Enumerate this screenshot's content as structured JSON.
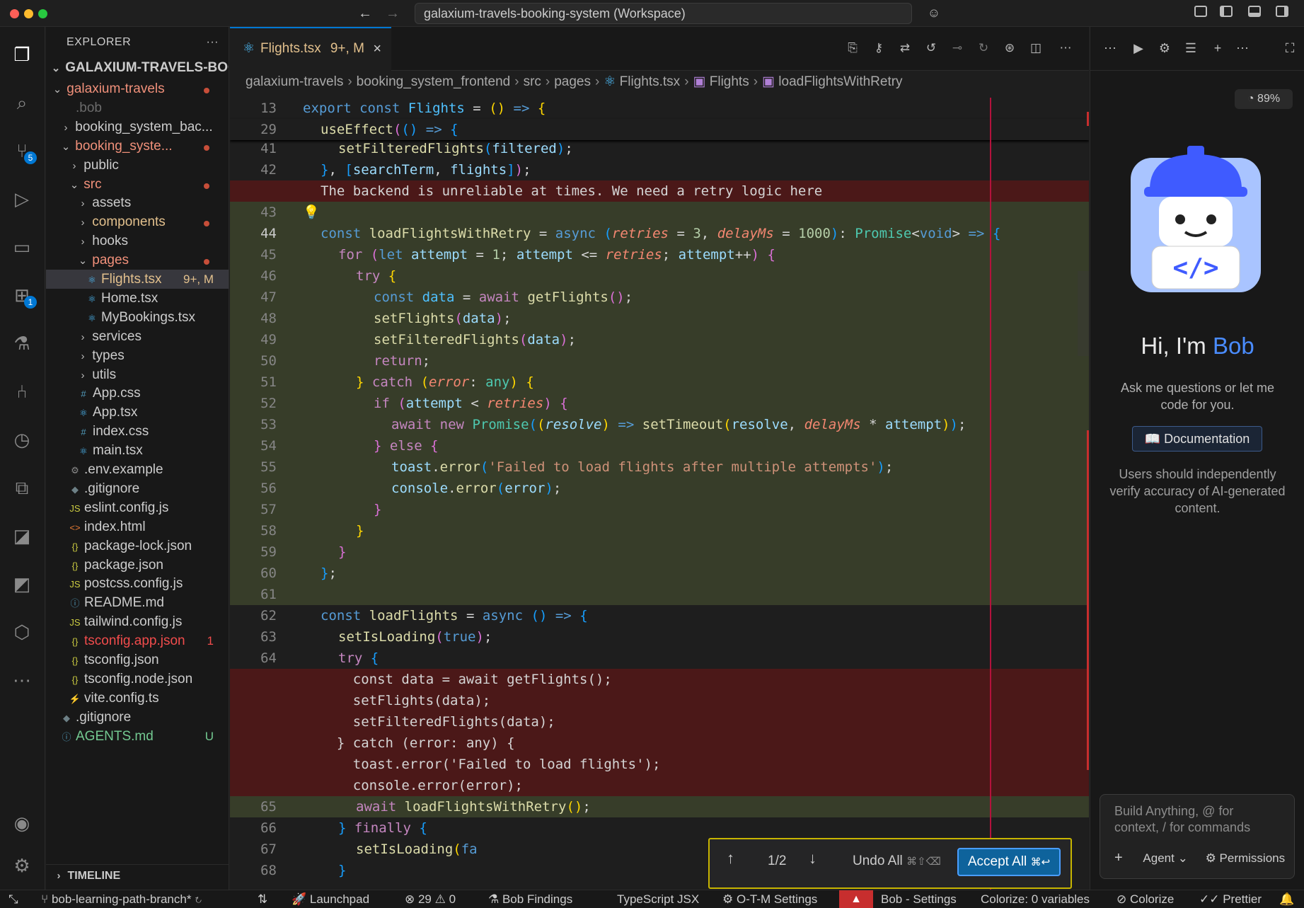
{
  "titlebar": {
    "command_center": "galaxium-travels-booking-system (Workspace)"
  },
  "activity": {
    "source_control_badge": "5",
    "extensions_badge": "1"
  },
  "explorer": {
    "title": "EXPLORER",
    "more": "···",
    "workspace_root": "GALAXIUM-TRAVELS-BOO...",
    "items": [
      {
        "label": "galaxium-travels",
        "depth": 0,
        "chev": "⌄",
        "color": "#f0907a"
      },
      {
        "label": ".bob",
        "depth": 1,
        "chev": "",
        "color": "#6b6b6b"
      },
      {
        "label": "booking_system_bac...",
        "depth": 1,
        "chev": "›",
        "color": "#cccccc"
      },
      {
        "label": "booking_syste...",
        "depth": 1,
        "chev": "⌄",
        "color": "#f0907a"
      },
      {
        "label": "public",
        "depth": 2,
        "chev": "›",
        "color": "#cccccc"
      },
      {
        "label": "src",
        "depth": 2,
        "chev": "⌄",
        "color": "#f0907a"
      },
      {
        "label": "assets",
        "depth": 3,
        "chev": "›",
        "color": "#cccccc"
      },
      {
        "label": "components",
        "depth": 3,
        "chev": "›",
        "color": "#e2c08d"
      },
      {
        "label": "hooks",
        "depth": 3,
        "chev": "›",
        "color": "#cccccc"
      },
      {
        "label": "pages",
        "depth": 3,
        "chev": "⌄",
        "color": "#f0907a"
      },
      {
        "label": "Flights.tsx",
        "depth": 4,
        "chev": "",
        "color": "#e2c08d",
        "trail": "9+, M"
      },
      {
        "label": "Home.tsx",
        "depth": 4,
        "chev": "",
        "color": "#cccccc"
      },
      {
        "label": "MyBookings.tsx",
        "depth": 4,
        "chev": "",
        "color": "#cccccc"
      },
      {
        "label": "services",
        "depth": 3,
        "chev": "›",
        "color": "#cccccc"
      },
      {
        "label": "types",
        "depth": 3,
        "chev": "›",
        "color": "#cccccc"
      },
      {
        "label": "utils",
        "depth": 3,
        "chev": "›",
        "color": "#cccccc"
      },
      {
        "label": "App.css",
        "depth": 3,
        "chev": "",
        "color": "#cccccc"
      },
      {
        "label": "App.tsx",
        "depth": 3,
        "chev": "",
        "color": "#cccccc"
      },
      {
        "label": "index.css",
        "depth": 3,
        "chev": "",
        "color": "#cccccc"
      },
      {
        "label": "main.tsx",
        "depth": 3,
        "chev": "",
        "color": "#cccccc"
      },
      {
        "label": ".env.example",
        "depth": 2,
        "chev": "",
        "color": "#cccccc"
      },
      {
        "label": ".gitignore",
        "depth": 2,
        "chev": "",
        "color": "#cccccc"
      },
      {
        "label": "eslint.config.js",
        "depth": 2,
        "chev": "",
        "color": "#cccccc"
      },
      {
        "label": "index.html",
        "depth": 2,
        "chev": "",
        "color": "#cccccc"
      },
      {
        "label": "package-lock.json",
        "depth": 2,
        "chev": "",
        "color": "#cccccc"
      },
      {
        "label": "package.json",
        "depth": 2,
        "chev": "",
        "color": "#cccccc"
      },
      {
        "label": "postcss.config.js",
        "depth": 2,
        "chev": "",
        "color": "#cccccc"
      },
      {
        "label": "README.md",
        "depth": 2,
        "chev": "",
        "color": "#cccccc"
      },
      {
        "label": "tailwind.config.js",
        "depth": 2,
        "chev": "",
        "color": "#cccccc"
      },
      {
        "label": "tsconfig.app.json",
        "depth": 2,
        "chev": "",
        "color": "#f14c4c",
        "trail": "1"
      },
      {
        "label": "tsconfig.json",
        "depth": 2,
        "chev": "",
        "color": "#cccccc"
      },
      {
        "label": "tsconfig.node.json",
        "depth": 2,
        "chev": "",
        "color": "#cccccc"
      },
      {
        "label": "vite.config.ts",
        "depth": 2,
        "chev": "",
        "color": "#cccccc"
      },
      {
        "label": ".gitignore",
        "depth": 1,
        "chev": "",
        "color": "#cccccc"
      },
      {
        "label": "AGENTS.md",
        "depth": 1,
        "chev": "",
        "color": "#73c991",
        "trail": "U"
      }
    ],
    "timeline": "TIMELINE"
  },
  "editor": {
    "tab": {
      "label": "Flights.tsx",
      "status": "9+, M"
    },
    "breadcrumbs": [
      "galaxium-travels",
      "booking_system_frontend",
      "src",
      "pages",
      "Flights.tsx",
      "Flights",
      "loadFlightsWithRetry"
    ],
    "line_numbers": [
      "13",
      "29",
      "41",
      "42",
      "",
      "43",
      "44",
      "45",
      "46",
      "47",
      "48",
      "49",
      "50",
      "51",
      "52",
      "53",
      "54",
      "55",
      "56",
      "57",
      "58",
      "59",
      "60",
      "61",
      "62",
      "63",
      "64",
      "",
      "",
      "",
      "",
      "",
      "",
      "65",
      "66",
      "67",
      "68"
    ],
    "comment_line": "The backend is unreliable at times. We need a retry logic here",
    "deleted_lines": [
      "    const data = await getFlights();",
      "    setFlights(data);",
      "    setFilteredFlights(data);",
      "  } catch (error: any) {",
      "    toast.error('Failed to load flights');",
      "    console.error(error);"
    ]
  },
  "diff_toolbar": {
    "counter": "1/2",
    "undo_all": "Undo All",
    "undo_shortcut": "⌘⇧⌫",
    "accept_all": "Accept All",
    "accept_shortcut": "⌘↩"
  },
  "bob": {
    "usage": "89%",
    "greeting_prefix": "Hi, I'm",
    "greeting_name": "Bob",
    "subtitle": "Ask me questions or let me code for you.",
    "documentation": "Documentation",
    "disclaimer": "Users should independently verify accuracy of AI-generated content.",
    "input_placeholder": "Build Anything, @ for context, / for commands",
    "mode": "Agent",
    "permissions": "Permissions"
  },
  "statusbar": {
    "branch": "bob-learning-path-branch*",
    "launchpad": "Launchpad",
    "errors": "29",
    "warnings": "0",
    "findings": "Bob Findings",
    "language": "TypeScript JSX",
    "otm": "O-T-M Settings",
    "bob_settings": "Bob - Settings",
    "colorize_vars": "Colorize: 0 variables",
    "colorize": "Colorize",
    "prettier": "Prettier"
  },
  "colors": {
    "accent": "#0078d4",
    "deleted_bg": "#4b1818",
    "added_bg": "#373d29",
    "bob_blue": "#4a8cff"
  }
}
